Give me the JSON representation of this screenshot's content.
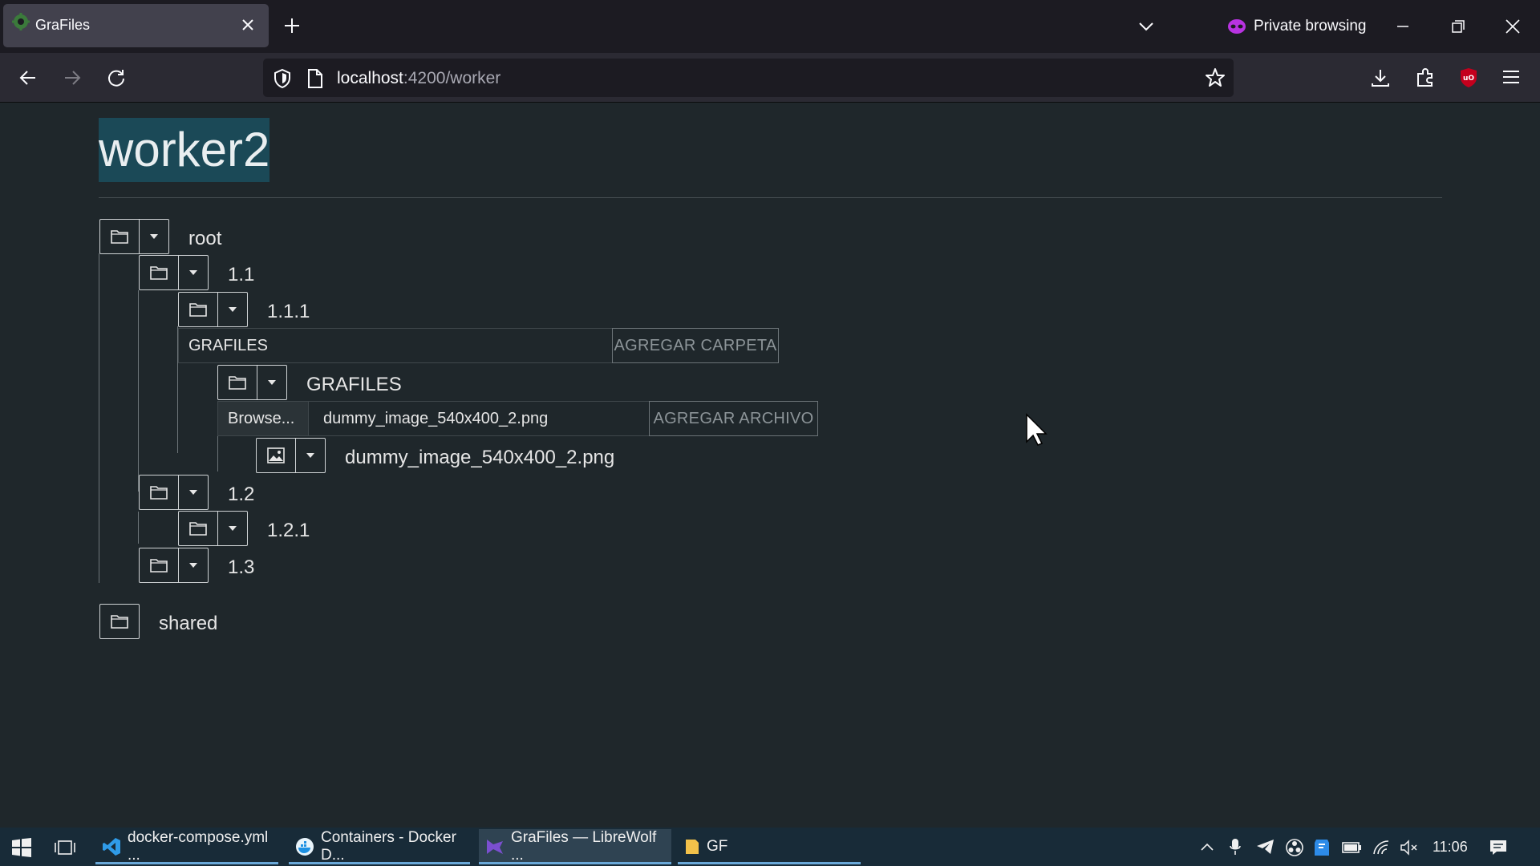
{
  "browser": {
    "tab_title": "GraFiles",
    "private_label": "Private browsing",
    "url_host": "localhost",
    "url_path": ":4200/worker"
  },
  "page": {
    "heading": "worker2",
    "tree": {
      "root": "root",
      "n1_1": "1.1",
      "n1_1_1": "1.1.1",
      "folder_input_value": "GRAFILES",
      "add_folder_button": "AGREGAR CARPETA",
      "grafiles_folder": "GRAFILES",
      "browse_button": "Browse...",
      "file_input_value": "dummy_image_540x400_2.png",
      "add_file_button": "AGREGAR ARCHIVO",
      "file_name": "dummy_image_540x400_2.png",
      "n1_2": "1.2",
      "n1_2_1": "1.2.1",
      "n1_3": "1.3",
      "shared": "shared"
    }
  },
  "taskbar": {
    "items": [
      {
        "label": "docker-compose.yml ..."
      },
      {
        "label": "Containers - Docker D..."
      },
      {
        "label": "GraFiles — LibreWolf ..."
      },
      {
        "label": "GF"
      }
    ],
    "clock": "11:06"
  },
  "colors": {
    "page_bg": "#1f272b",
    "heading_highlight": "#1b4957",
    "taskbar_bg": "#182b38",
    "ublock_red": "#c4001d"
  }
}
